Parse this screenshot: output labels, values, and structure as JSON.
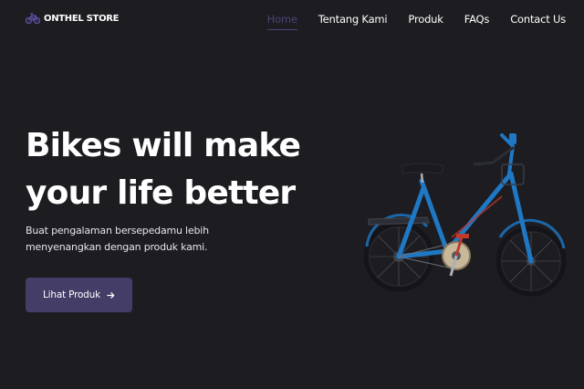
{
  "navbar": {
    "brand": "ONTHEL STORE",
    "brand_icon": "bicycle-icon",
    "links": [
      {
        "label": "Home",
        "active": true
      },
      {
        "label": "Tentang Kami",
        "active": false
      },
      {
        "label": "Produk",
        "active": false
      },
      {
        "label": "FAQs",
        "active": false
      },
      {
        "label": "Contact Us",
        "active": false
      }
    ]
  },
  "hero": {
    "title_line1": "Bikes will make",
    "title_line2": "your life better",
    "subtitle_line1": "Buat pengalaman bersepedamu lebih",
    "subtitle_line2": "menyenangkan dengan produk kami.",
    "cta_label": "Lihat Produk",
    "cta_icon": "arrow-right-icon",
    "image": "blue-bicycle-photo"
  },
  "colors": {
    "background": "#1d1c21",
    "accent": "#433d67",
    "active_link": "#4b4577",
    "text": "#ffffff"
  }
}
